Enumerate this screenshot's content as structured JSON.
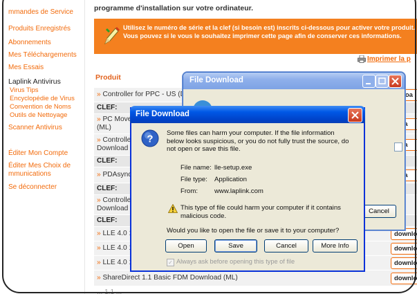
{
  "sidebar": {
    "links": [
      {
        "label": "mmandes de Service"
      },
      {
        "label": "Produits Enregistrés"
      },
      {
        "label": "Abonnements"
      },
      {
        "label": "Mes Téléchargements"
      },
      {
        "label": "Mes Essais"
      }
    ],
    "section_title": "Laplink Antivirus",
    "sub_links": [
      {
        "label": "Virus Tips"
      },
      {
        "label": "Encyclopédie de Virus"
      },
      {
        "label": "Convention de Noms"
      },
      {
        "label": "Outils de Nettoyage"
      }
    ],
    "scanner": "Scanner Antivirus",
    "edit_account": "Éditer Mon Compte",
    "edit_comm_1": "Éditer Mes Choix de",
    "edit_comm_2": "mmunications",
    "logout": "Se déconnecter"
  },
  "main": {
    "intro": "programme d'installation sur votre ordinateur.",
    "notice": "Utilisez le numéro de série et la clef (si besoin est) inscrits ci-dessous pour activer votre produit. Vous pouvez si le vous le souhaitez imprimer cette page afin de conserver ces informations.",
    "print_label": "Imprimer la p",
    "column_header": "Produit",
    "clef_label": "CLEF:",
    "rows": [
      {
        "text": "Controller for PPC - US (D",
        "download": "wnloa"
      },
      {
        "text": "PC Move",
        "text2": "(ML)",
        "download": "nloa"
      },
      {
        "text": "Controlle",
        "text2": "Download",
        "download": "nloa"
      },
      {
        "text": "PDAsync",
        "download": "nloa"
      },
      {
        "text": "Controlle",
        "text2": "Download",
        "download": ""
      },
      {
        "text": "LLE 4.0 1",
        "download": "downloa"
      },
      {
        "text": "LLE 4.0 1",
        "download": "downloa"
      },
      {
        "text": "LLE 4.0 1",
        "download": "downloa"
      },
      {
        "text": "ShareDirect 1.1 Basic FDM Download (ML)",
        "download": "downloa"
      }
    ],
    "bottom_fragment": "...  1.1 ..."
  },
  "bg_dialog": {
    "title": "File Download",
    "cancel_label": "Cancel"
  },
  "dialog": {
    "title": "File Download",
    "warning": "Some files can harm your computer. If the file information below looks suspicious, or you do not fully trust the source, do not open or save this file.",
    "file_name_label": "File name:",
    "file_name": "lle-setup.exe",
    "file_type_label": "File type:",
    "file_type": "Application",
    "from_label": "From:",
    "from": "www.laplink.com",
    "caution": "This type of file could harm your computer if it contains malicious code.",
    "question": "Would you like to open the file or save it to your computer?",
    "buttons": {
      "open": "Open",
      "save": "Save",
      "cancel": "Cancel",
      "more_info": "More Info"
    },
    "always_ask": "Always ask before opening this type of file",
    "always_ask_checked": true
  },
  "colors": {
    "accent": "#f26a0a",
    "notice_bg": "#f4801f",
    "xp_title": "#0058e6",
    "dialog_bg": "#ece9d8"
  }
}
